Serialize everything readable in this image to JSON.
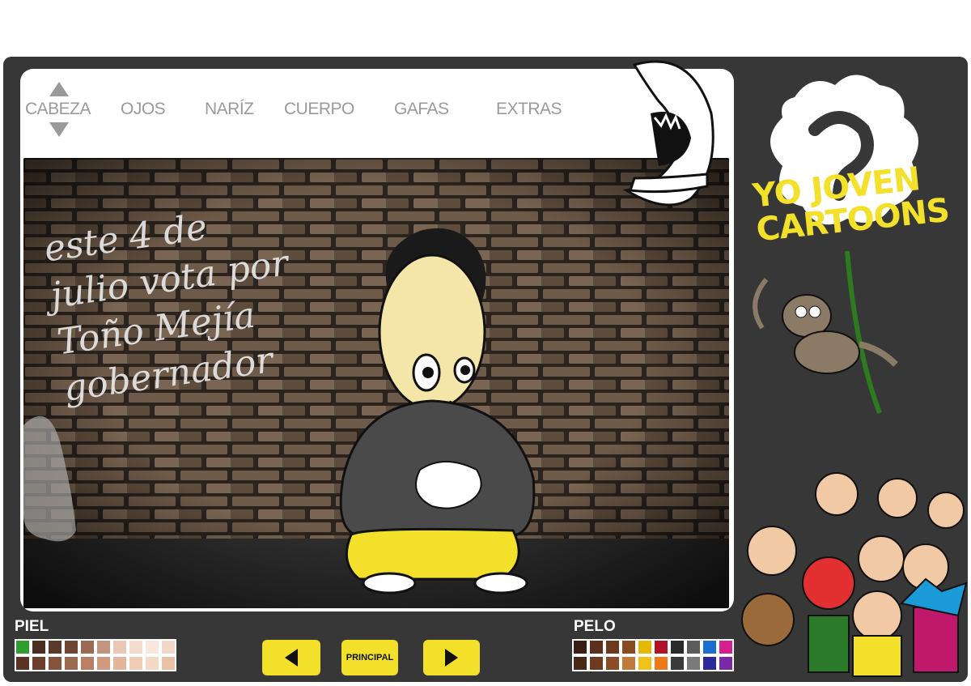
{
  "tabs": {
    "head": "CABEZA",
    "eyes": "OJOS",
    "nose": "NARÍZ",
    "body": "CUERPO",
    "glasses": "GAFAS",
    "extras": "EXTRAS"
  },
  "graffiti": {
    "line1": "este 4 de",
    "line2": "julio vota por",
    "line3": "Toño Mejía",
    "line4": "gobernador"
  },
  "brand": {
    "line1": "YO JOVEN",
    "line2": "CARTOONS"
  },
  "skin_palette": {
    "label": "PIEL",
    "row1": [
      "#2e9e2e",
      "#4a2f21",
      "#5a3a2a",
      "#6f4636",
      "#9a6a55",
      "#c39480",
      "#e8c8b4",
      "#f3dccd",
      "#f7e7dc",
      "#f2d7c8",
      "#c99684"
    ],
    "row2": [
      "#5a3525",
      "#6b3f2b",
      "#84533c",
      "#9d6a52",
      "#b98065",
      "#d09a7e",
      "#e3b69a",
      "#efcdb4",
      "#f4dac6",
      "#e9c2a6",
      "#a87460"
    ]
  },
  "hair_palette": {
    "label": "PELO",
    "row1": [
      "#3a1e14",
      "#5a2f1b",
      "#6b3a1e",
      "#8a4a22",
      "#e6b800",
      "#b0122a",
      "#2a2a2a",
      "#5c5c5c",
      "#1a6fd1",
      "#d61f8e",
      "#2aa64a"
    ],
    "row2": [
      "#4a2818",
      "#6e3a20",
      "#8c4c26",
      "#c07a3a",
      "#f0c21a",
      "#f07818",
      "#3a3a3a",
      "#7a7a7a",
      "#2a2a9a",
      "#7a2aa8",
      "#1e9e3a"
    ]
  },
  "nav": {
    "principal": "PRINCIPAL"
  },
  "colors": {
    "accent_yellow": "#f2e02a",
    "frame": "#373737",
    "tab_text": "#9a9a9a"
  }
}
